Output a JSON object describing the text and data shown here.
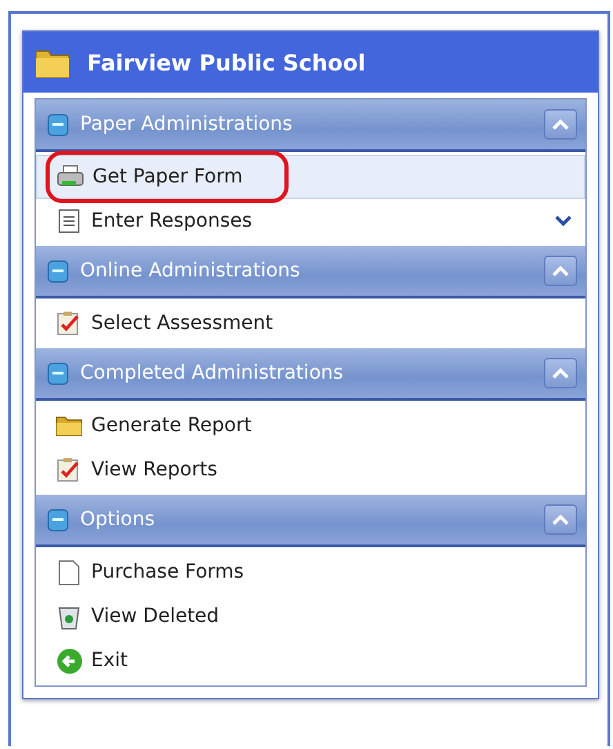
{
  "panel": {
    "title": "Fairview Public School"
  },
  "sections": [
    {
      "title": "Paper Administrations",
      "expanded": true,
      "items": [
        {
          "label": "Get Paper Form",
          "kind": "printer",
          "selected": true,
          "circled": true,
          "more": false
        },
        {
          "label": "Enter Responses",
          "kind": "list",
          "selected": false,
          "circled": false,
          "more": true
        }
      ]
    },
    {
      "title": "Online Administrations",
      "expanded": true,
      "items": [
        {
          "label": "Select Assessment",
          "kind": "clipboard",
          "selected": false,
          "circled": false,
          "more": false
        }
      ]
    },
    {
      "title": "Completed Administrations",
      "expanded": true,
      "items": [
        {
          "label": "Generate Report",
          "kind": "folder",
          "selected": false,
          "circled": false,
          "more": false
        },
        {
          "label": "View Reports",
          "kind": "clipboard",
          "selected": false,
          "circled": false,
          "more": false
        }
      ]
    },
    {
      "title": "Options",
      "expanded": true,
      "items": [
        {
          "label": "Purchase Forms",
          "kind": "page",
          "selected": false,
          "circled": false,
          "more": false
        },
        {
          "label": "View Deleted",
          "kind": "bin",
          "selected": false,
          "circled": false,
          "more": false
        },
        {
          "label": "Exit",
          "kind": "exit",
          "selected": false,
          "circled": false,
          "more": false
        }
      ]
    }
  ]
}
